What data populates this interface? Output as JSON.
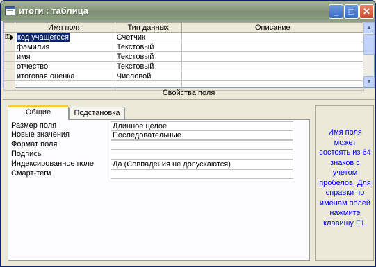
{
  "window": {
    "title": "итоги : таблица",
    "minimize": "_",
    "maximize": "□",
    "close": "✕"
  },
  "grid": {
    "headers": [
      "Имя поля",
      "Тип данных",
      "Описание"
    ],
    "rows": [
      {
        "name": "код учащегося",
        "type": "Счетчик",
        "desc": ""
      },
      {
        "name": "фамилия",
        "type": "Текстовый",
        "desc": ""
      },
      {
        "name": "имя",
        "type": "Текстовый",
        "desc": ""
      },
      {
        "name": "отчество",
        "type": "Текстовый",
        "desc": ""
      },
      {
        "name": "итоговая оценка",
        "type": "Числовой",
        "desc": ""
      },
      {
        "name": "",
        "type": "",
        "desc": ""
      }
    ]
  },
  "properties": {
    "section_title": "Свойства поля",
    "tabs": [
      "Общие",
      "Подстановка"
    ],
    "active_tab": "Общие",
    "items": [
      {
        "label": "Размер поля",
        "value": "Длинное целое"
      },
      {
        "label": "Новые значения",
        "value": "Последовательные"
      },
      {
        "label": "Формат поля",
        "value": ""
      },
      {
        "label": "Подпись",
        "value": ""
      },
      {
        "label": "Индексированное поле",
        "value": "Да (Совпадения не допускаются)"
      },
      {
        "label": "Смарт-теги",
        "value": ""
      }
    ],
    "hint": "Имя поля может состоять из 64 знаков с учетом пробелов. Для справки по именам полей нажмите клавишу F1."
  },
  "icons": {
    "key": "key-icon",
    "row_selector": "current-row-arrow-icon"
  },
  "colors": {
    "hint_text": "#0000ff",
    "selection": "#0a246a",
    "titlebar": "#8a9a7e"
  }
}
